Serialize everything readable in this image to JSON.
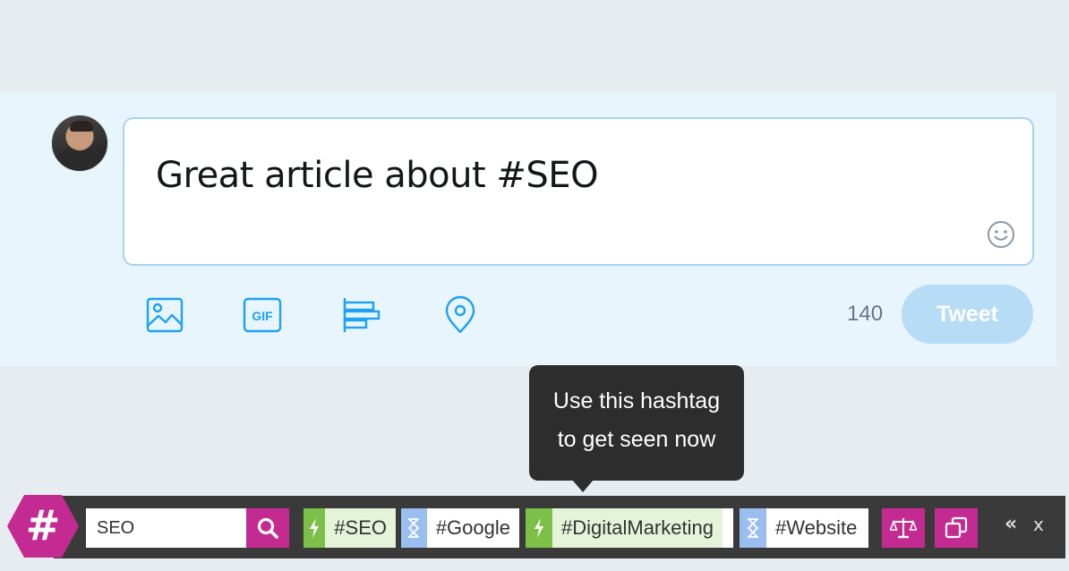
{
  "composer": {
    "tweet_text": "Great article about #SEO",
    "char_count": "140",
    "tweet_button_label": "Tweet",
    "tools": [
      "image-icon",
      "gif-icon",
      "poll-icon",
      "location-icon"
    ],
    "gif_label": "GIF",
    "accent_color": "#1da1f2"
  },
  "tooltip": {
    "line1": "Use this hashtag",
    "line2": "to get seen now"
  },
  "toolbar": {
    "logo_symbol": "#",
    "search_value": "SEO",
    "hashtags": [
      {
        "label": "#SEO",
        "status": "hot",
        "icon": "lightning-icon",
        "color": "#7cc04a"
      },
      {
        "label": "#Google",
        "status": "overused",
        "icon": "hourglass-icon",
        "color": "#9bbef1"
      },
      {
        "label": "#DigitalMarketing",
        "status": "hot",
        "icon": "lightning-icon",
        "color": "#7cc04a"
      },
      {
        "label": "#Website",
        "status": "overused",
        "icon": "hourglass-icon",
        "color": "#9bbef1"
      }
    ],
    "collapse_label": "«",
    "close_label": "x",
    "brand_color": "#c42b92"
  }
}
